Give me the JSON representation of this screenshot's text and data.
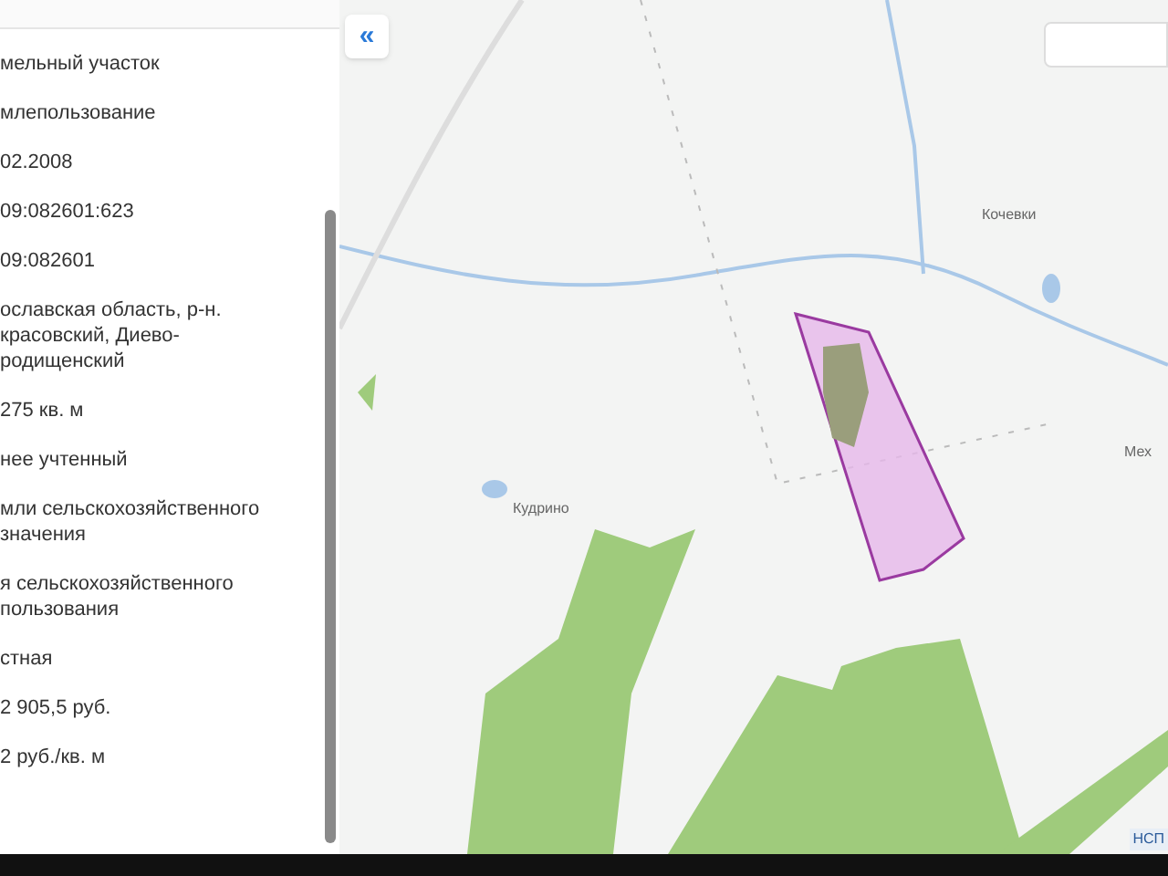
{
  "sidebar": {
    "collapse_button": "«",
    "fields": [
      "мельный участок",
      "млепользование",
      "02.2008",
      "09:082601:623",
      "09:082601",
      "ославская область, р-н. красовский, Диево-родищенский",
      "275 кв. м",
      "нее учтенный",
      "мли сельскохозяйственного значения",
      "я сельскохозяйственного пользования",
      "стная",
      "2 905,5 руб.",
      "2 руб./кв. м"
    ]
  },
  "map": {
    "labels": [
      "Кочевки",
      "Кудрино",
      "Мех"
    ],
    "corner_badge": "НСП"
  }
}
